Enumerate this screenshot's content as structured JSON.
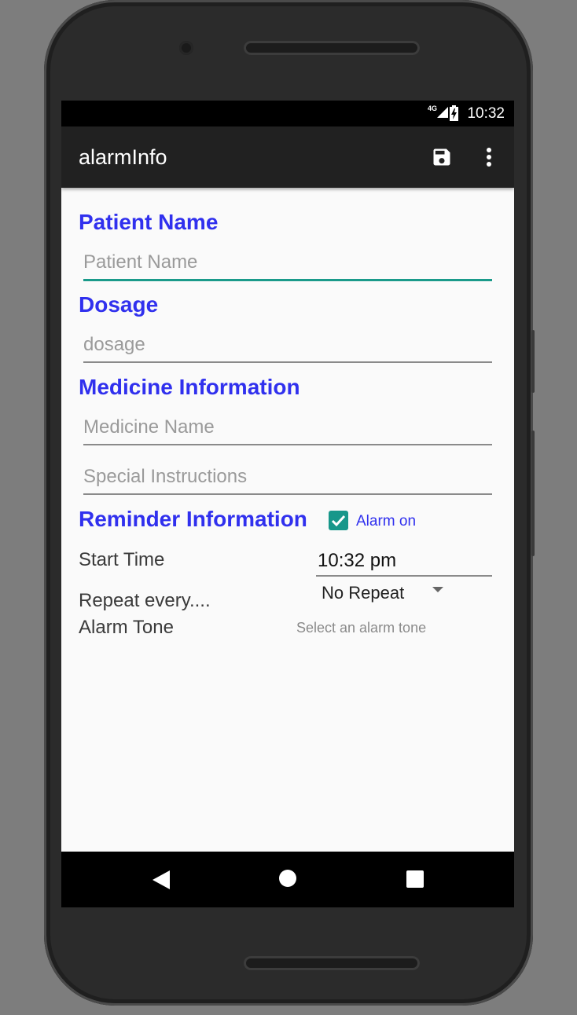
{
  "status_bar": {
    "network": "4G",
    "time": "10:32"
  },
  "app_bar": {
    "title": "alarmInfo",
    "actions": [
      {
        "icon": "save-icon"
      },
      {
        "icon": "more-vert-icon"
      }
    ]
  },
  "form": {
    "patient_heading": "Patient Name",
    "patient_placeholder": "Patient Name",
    "dosage_heading": "Dosage",
    "dosage_placeholder": "dosage",
    "medicine_heading": "Medicine Information",
    "medicine_name_placeholder": "Medicine Name",
    "special_instructions_placeholder": "Special Instructions",
    "reminder_heading": "Reminder Information",
    "alarm_on_label": "Alarm on",
    "alarm_on_checked": true,
    "start_time_label": "Start Time",
    "start_time_value": "10:32 pm",
    "repeat_label": "Repeat every....",
    "repeat_value": "No Repeat",
    "alarm_tone_label": "Alarm Tone",
    "alarm_tone_value": "Select an alarm tone"
  },
  "colors": {
    "heading": "#3030ee",
    "accent": "#17978a",
    "app_bar": "#212121"
  }
}
